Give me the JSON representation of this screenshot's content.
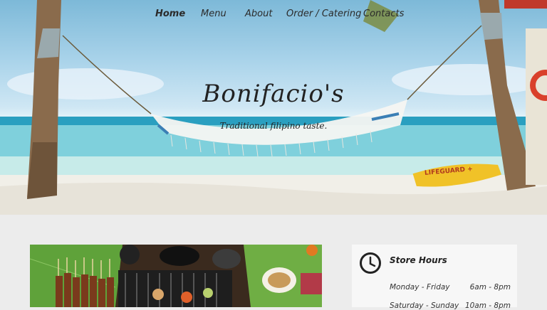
{
  "nav": {
    "items": [
      {
        "label": "Home",
        "active": true
      },
      {
        "label": "Menu",
        "active": false
      },
      {
        "label": "About",
        "active": false
      },
      {
        "label": "Order / Catering",
        "active": false
      },
      {
        "label": "Contacts",
        "active": false
      }
    ]
  },
  "hero": {
    "title": "Bonifacio's",
    "tagline": "Traditional filipino taste.",
    "lifeguard_text": "LIFEGUARD +"
  },
  "hours": {
    "title": "Store Hours",
    "icon": "clock-icon",
    "rows": [
      {
        "day": "Monday - Friday",
        "time": "6am - 8pm"
      },
      {
        "day": "Saturday - Sunday",
        "time": "10am - 8pm"
      }
    ]
  },
  "colors": {
    "page_bg": "#ececec",
    "card_bg": "#f7f7f7",
    "text": "#222222",
    "sea": "#2fb0c8",
    "sand": "#f1efe8"
  }
}
